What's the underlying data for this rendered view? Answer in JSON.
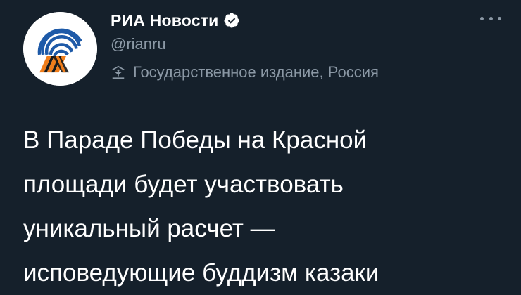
{
  "author": {
    "name": "РИА Новости",
    "handle": "@rianru",
    "label": "Государственное издание, Россия",
    "verified": true
  },
  "icons": {
    "verified": "verified-badge-icon",
    "state": "government-building-icon",
    "more": "more-options-icon",
    "avatar": "ria-logo"
  },
  "colors": {
    "background": "#15202b",
    "text": "#ffffff",
    "secondary_text": "#8b98a5",
    "logo_blue": "#1e5aa8",
    "logo_orange": "#f07d1a"
  },
  "tweet": {
    "text": "В Параде Победы на Красной\nплощади будет участвовать\nуникальный расчет —\nисповедующие буддизм казаки"
  }
}
